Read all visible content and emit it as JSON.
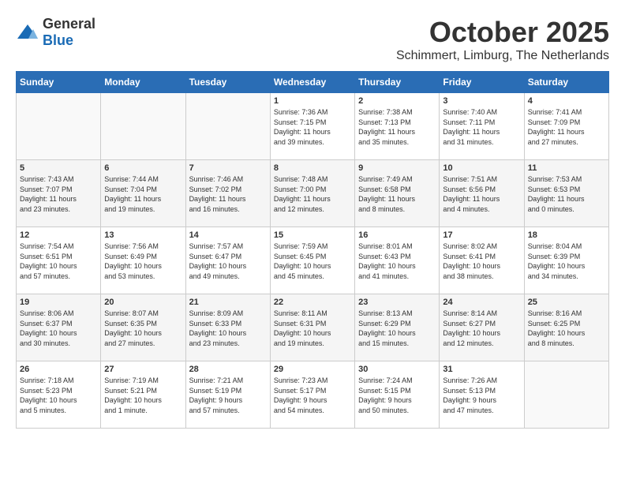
{
  "header": {
    "logo_general": "General",
    "logo_blue": "Blue",
    "month": "October 2025",
    "location": "Schimmert, Limburg, The Netherlands"
  },
  "days_of_week": [
    "Sunday",
    "Monday",
    "Tuesday",
    "Wednesday",
    "Thursday",
    "Friday",
    "Saturday"
  ],
  "weeks": [
    [
      {
        "day": "",
        "content": ""
      },
      {
        "day": "",
        "content": ""
      },
      {
        "day": "",
        "content": ""
      },
      {
        "day": "1",
        "content": "Sunrise: 7:36 AM\nSunset: 7:15 PM\nDaylight: 11 hours\nand 39 minutes."
      },
      {
        "day": "2",
        "content": "Sunrise: 7:38 AM\nSunset: 7:13 PM\nDaylight: 11 hours\nand 35 minutes."
      },
      {
        "day": "3",
        "content": "Sunrise: 7:40 AM\nSunset: 7:11 PM\nDaylight: 11 hours\nand 31 minutes."
      },
      {
        "day": "4",
        "content": "Sunrise: 7:41 AM\nSunset: 7:09 PM\nDaylight: 11 hours\nand 27 minutes."
      }
    ],
    [
      {
        "day": "5",
        "content": "Sunrise: 7:43 AM\nSunset: 7:07 PM\nDaylight: 11 hours\nand 23 minutes."
      },
      {
        "day": "6",
        "content": "Sunrise: 7:44 AM\nSunset: 7:04 PM\nDaylight: 11 hours\nand 19 minutes."
      },
      {
        "day": "7",
        "content": "Sunrise: 7:46 AM\nSunset: 7:02 PM\nDaylight: 11 hours\nand 16 minutes."
      },
      {
        "day": "8",
        "content": "Sunrise: 7:48 AM\nSunset: 7:00 PM\nDaylight: 11 hours\nand 12 minutes."
      },
      {
        "day": "9",
        "content": "Sunrise: 7:49 AM\nSunset: 6:58 PM\nDaylight: 11 hours\nand 8 minutes."
      },
      {
        "day": "10",
        "content": "Sunrise: 7:51 AM\nSunset: 6:56 PM\nDaylight: 11 hours\nand 4 minutes."
      },
      {
        "day": "11",
        "content": "Sunrise: 7:53 AM\nSunset: 6:53 PM\nDaylight: 11 hours\nand 0 minutes."
      }
    ],
    [
      {
        "day": "12",
        "content": "Sunrise: 7:54 AM\nSunset: 6:51 PM\nDaylight: 10 hours\nand 57 minutes."
      },
      {
        "day": "13",
        "content": "Sunrise: 7:56 AM\nSunset: 6:49 PM\nDaylight: 10 hours\nand 53 minutes."
      },
      {
        "day": "14",
        "content": "Sunrise: 7:57 AM\nSunset: 6:47 PM\nDaylight: 10 hours\nand 49 minutes."
      },
      {
        "day": "15",
        "content": "Sunrise: 7:59 AM\nSunset: 6:45 PM\nDaylight: 10 hours\nand 45 minutes."
      },
      {
        "day": "16",
        "content": "Sunrise: 8:01 AM\nSunset: 6:43 PM\nDaylight: 10 hours\nand 41 minutes."
      },
      {
        "day": "17",
        "content": "Sunrise: 8:02 AM\nSunset: 6:41 PM\nDaylight: 10 hours\nand 38 minutes."
      },
      {
        "day": "18",
        "content": "Sunrise: 8:04 AM\nSunset: 6:39 PM\nDaylight: 10 hours\nand 34 minutes."
      }
    ],
    [
      {
        "day": "19",
        "content": "Sunrise: 8:06 AM\nSunset: 6:37 PM\nDaylight: 10 hours\nand 30 minutes."
      },
      {
        "day": "20",
        "content": "Sunrise: 8:07 AM\nSunset: 6:35 PM\nDaylight: 10 hours\nand 27 minutes."
      },
      {
        "day": "21",
        "content": "Sunrise: 8:09 AM\nSunset: 6:33 PM\nDaylight: 10 hours\nand 23 minutes."
      },
      {
        "day": "22",
        "content": "Sunrise: 8:11 AM\nSunset: 6:31 PM\nDaylight: 10 hours\nand 19 minutes."
      },
      {
        "day": "23",
        "content": "Sunrise: 8:13 AM\nSunset: 6:29 PM\nDaylight: 10 hours\nand 15 minutes."
      },
      {
        "day": "24",
        "content": "Sunrise: 8:14 AM\nSunset: 6:27 PM\nDaylight: 10 hours\nand 12 minutes."
      },
      {
        "day": "25",
        "content": "Sunrise: 8:16 AM\nSunset: 6:25 PM\nDaylight: 10 hours\nand 8 minutes."
      }
    ],
    [
      {
        "day": "26",
        "content": "Sunrise: 7:18 AM\nSunset: 5:23 PM\nDaylight: 10 hours\nand 5 minutes."
      },
      {
        "day": "27",
        "content": "Sunrise: 7:19 AM\nSunset: 5:21 PM\nDaylight: 10 hours\nand 1 minute."
      },
      {
        "day": "28",
        "content": "Sunrise: 7:21 AM\nSunset: 5:19 PM\nDaylight: 9 hours\nand 57 minutes."
      },
      {
        "day": "29",
        "content": "Sunrise: 7:23 AM\nSunset: 5:17 PM\nDaylight: 9 hours\nand 54 minutes."
      },
      {
        "day": "30",
        "content": "Sunrise: 7:24 AM\nSunset: 5:15 PM\nDaylight: 9 hours\nand 50 minutes."
      },
      {
        "day": "31",
        "content": "Sunrise: 7:26 AM\nSunset: 5:13 PM\nDaylight: 9 hours\nand 47 minutes."
      },
      {
        "day": "",
        "content": ""
      }
    ]
  ]
}
